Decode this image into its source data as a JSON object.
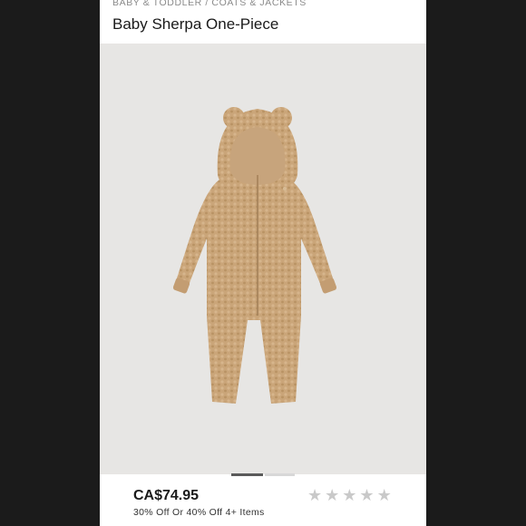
{
  "breadcrumb": "BABY & TODDLER / COATS & JACKETS",
  "product": {
    "title": "Baby Sherpa One-Piece",
    "price": "CA$74.95",
    "promo": "30% Off Or 40% Off 4+ Items",
    "rating_icon": "star-icon",
    "rating_filled": 0,
    "rating_max": 5
  },
  "carousel": {
    "current": 1,
    "total": 2
  },
  "colors": {
    "accent": "#5a5a5a",
    "garment": "#cba67a",
    "image_bg": "#e7e6e4",
    "star": "#c9c9c9"
  }
}
